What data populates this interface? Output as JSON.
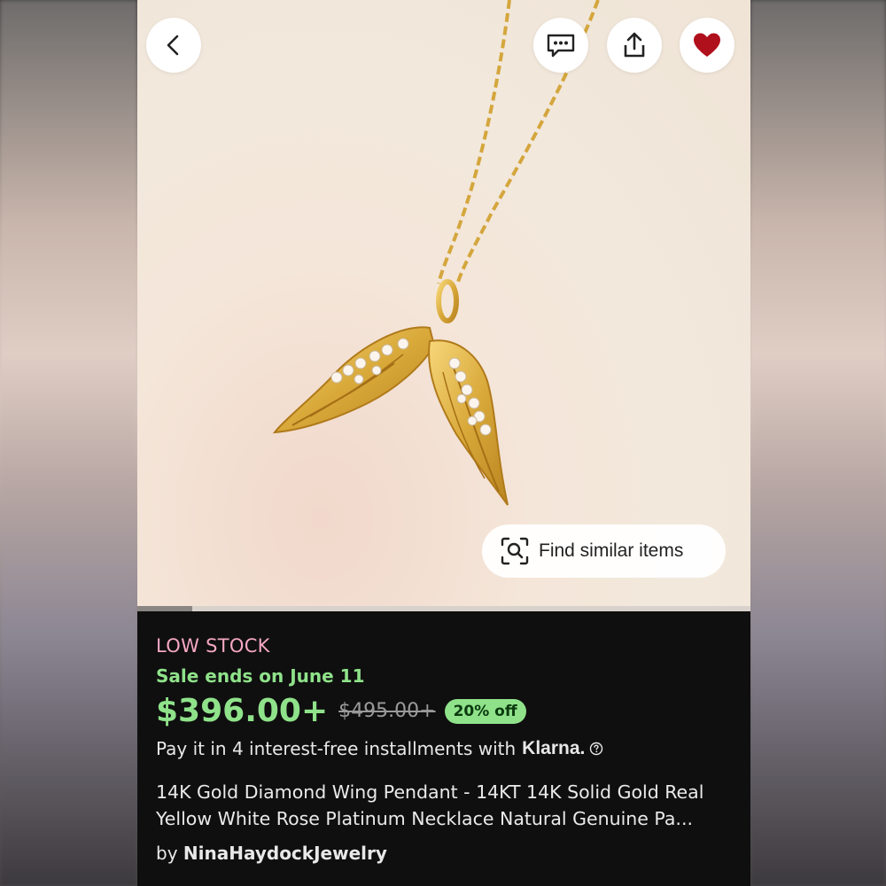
{
  "colors": {
    "accent_green": "#8fe28a",
    "low_stock_pink": "#f5a8c4",
    "favorite_red": "#b0101c",
    "panel_bg": "#0f0f0f"
  },
  "top_bar": {
    "back_icon": "chevron-left-icon",
    "message_icon": "message-dots-icon",
    "share_icon": "share-icon",
    "favorite_icon": "heart-icon"
  },
  "image": {
    "carousel_progress": 0.09,
    "find_similar_label": "Find similar items",
    "find_similar_icon": "visual-search-icon"
  },
  "listing": {
    "stock_status": "LOW STOCK",
    "sale_notice": "Sale ends on June 11",
    "price": "$396.00+",
    "original_price": "$495.00+",
    "discount_badge": "20% off",
    "installments_text": "Pay it in 4 interest-free installments with",
    "klarna_label": "Klarna.",
    "title_line_1": "14K Gold Diamond Wing Pendant - 14KT 14K Solid Gold Real",
    "title_line_2": "Yellow White Rose Platinum Necklace Natural Genuine Pa...",
    "by_label": "by",
    "seller_name": "NinaHaydockJewelry"
  }
}
